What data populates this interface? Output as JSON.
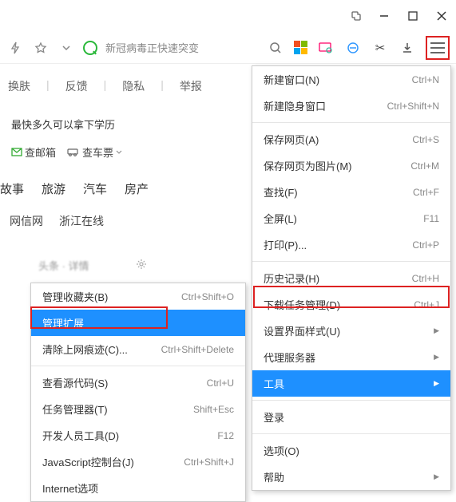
{
  "titlebar": {
    "ext": "⎘",
    "min": "—",
    "max": "☐",
    "close": "✕"
  },
  "toolbar": {
    "search_placeholder": "新冠病毒正快速突变",
    "scissors": "✂"
  },
  "bg": {
    "links": [
      "换肤",
      "反馈",
      "隐私",
      "举报"
    ],
    "body_line": "最快多久可以拿下学历",
    "mail": "查邮箱",
    "car": "查车票",
    "tabs1": [
      "故事",
      "旅游",
      "汽车",
      "房产"
    ],
    "tabs2": [
      "网信网",
      "浙江在线"
    ],
    "section": "头条  · 详情"
  },
  "main_menu": [
    {
      "label": "新建窗口(N)",
      "shortcut": "Ctrl+N"
    },
    {
      "label": "新建隐身窗口",
      "shortcut": "Ctrl+Shift+N"
    },
    {
      "sep": true
    },
    {
      "label": "保存网页(A)",
      "shortcut": "Ctrl+S"
    },
    {
      "label": "保存网页为图片(M)",
      "shortcut": "Ctrl+M"
    },
    {
      "label": "查找(F)",
      "shortcut": "Ctrl+F"
    },
    {
      "label": "全屏(L)",
      "shortcut": "F11"
    },
    {
      "label": "打印(P)...",
      "shortcut": "Ctrl+P"
    },
    {
      "sep": true
    },
    {
      "label": "历史记录(H)",
      "shortcut": "Ctrl+H"
    },
    {
      "label": "下载任务管理(D)",
      "shortcut": "Ctrl+J"
    },
    {
      "label": "设置界面样式(U)",
      "shortcut": "",
      "sub": true
    },
    {
      "label": "代理服务器",
      "shortcut": "",
      "sub": true
    },
    {
      "label": "工具",
      "shortcut": "",
      "sub": true,
      "hl": true
    },
    {
      "sep": true
    },
    {
      "label": "登录",
      "shortcut": ""
    },
    {
      "sep": true
    },
    {
      "label": "选项(O)",
      "shortcut": ""
    },
    {
      "label": "帮助",
      "shortcut": "",
      "sub": true
    }
  ],
  "submenu": [
    {
      "label": "管理收藏夹(B)",
      "shortcut": "Ctrl+Shift+O"
    },
    {
      "label": "管理扩展",
      "shortcut": "",
      "hl": true
    },
    {
      "label": "清除上网痕迹(C)...",
      "shortcut": "Ctrl+Shift+Delete"
    },
    {
      "sep": true
    },
    {
      "label": "查看源代码(S)",
      "shortcut": "Ctrl+U"
    },
    {
      "label": "任务管理器(T)",
      "shortcut": "Shift+Esc"
    },
    {
      "label": "开发人员工具(D)",
      "shortcut": "F12"
    },
    {
      "label": "JavaScript控制台(J)",
      "shortcut": "Ctrl+Shift+J"
    },
    {
      "label": "Internet选项",
      "shortcut": ""
    }
  ]
}
